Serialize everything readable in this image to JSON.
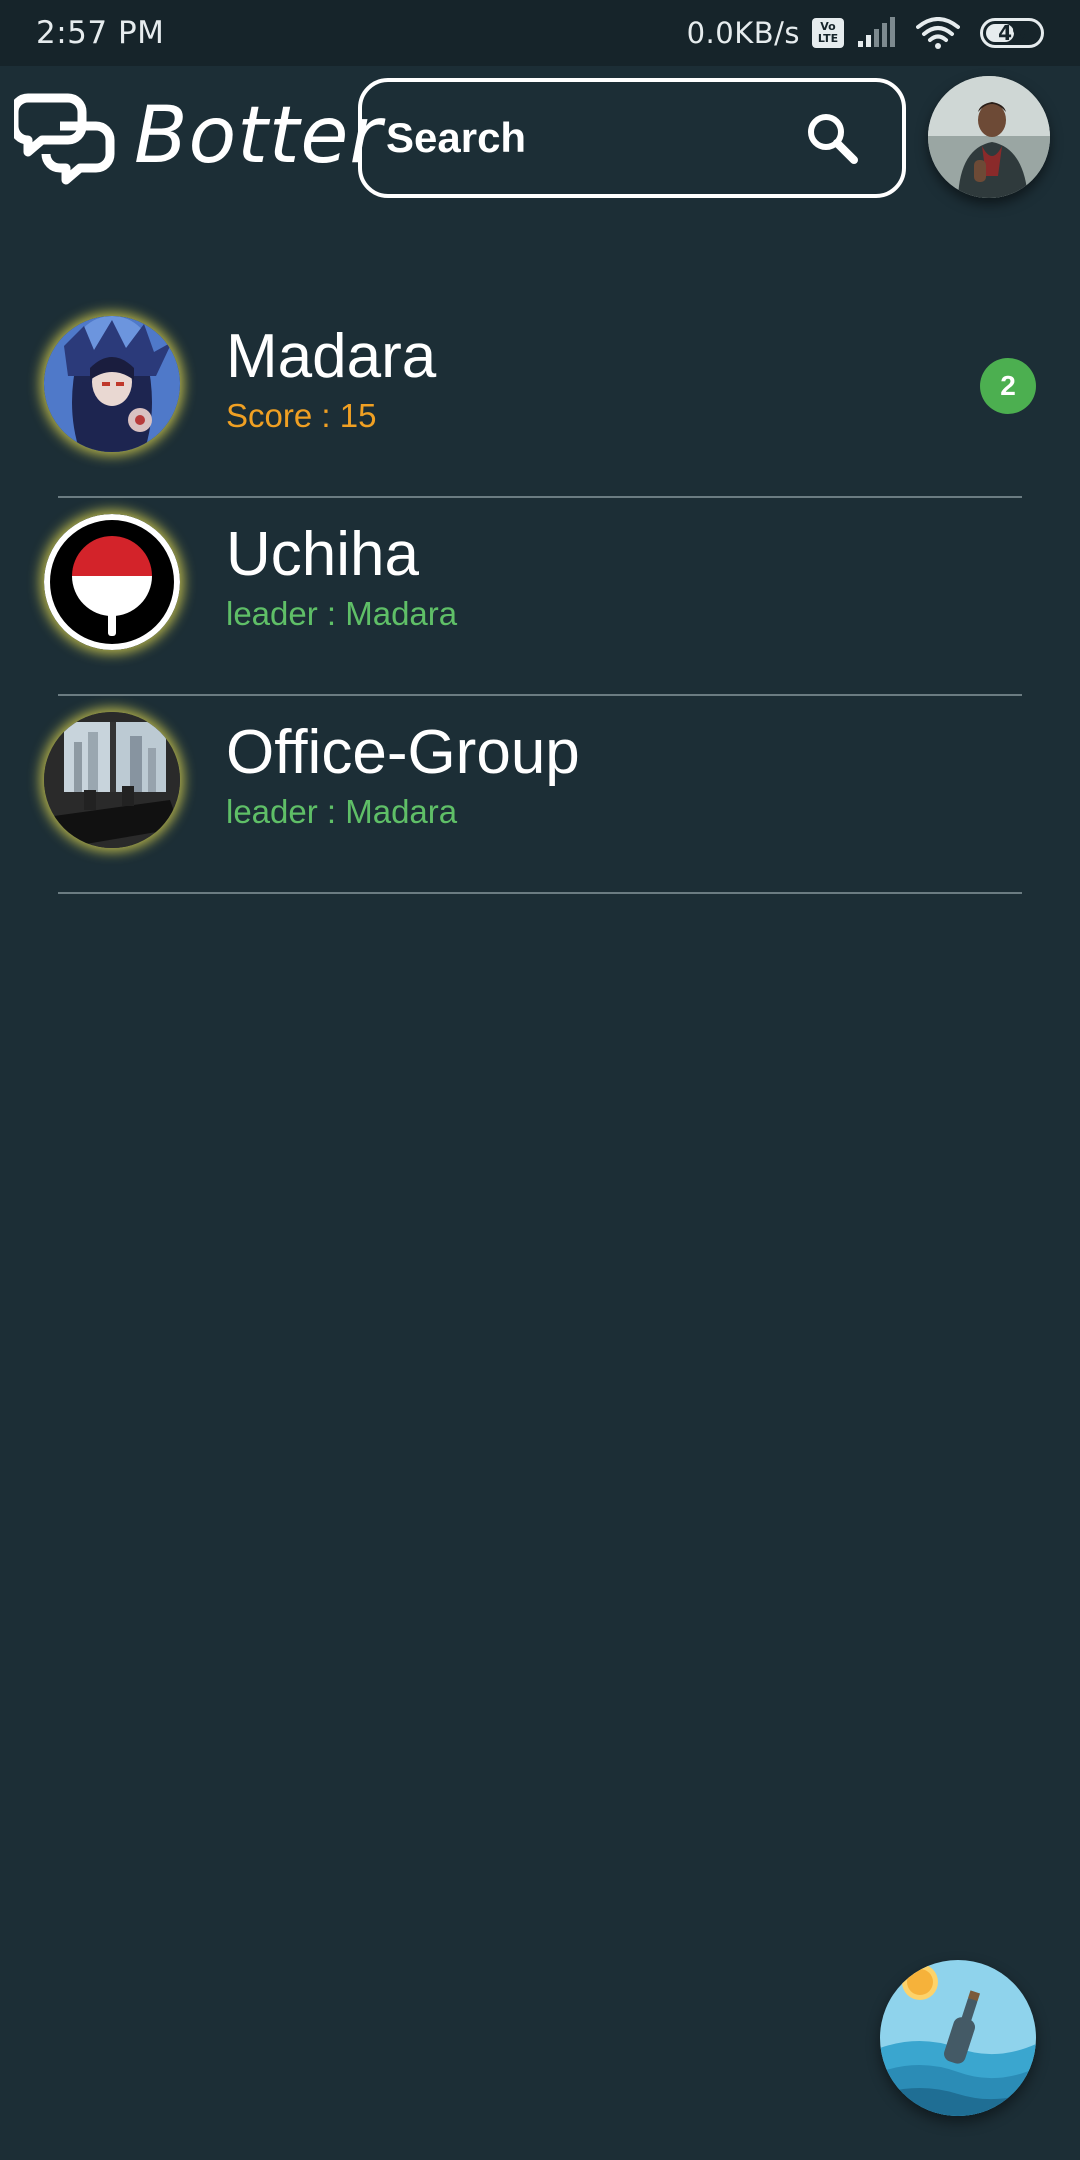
{
  "status_bar": {
    "time": "2:57 PM",
    "net_speed": "0.0KB/s",
    "volte_top": "Vo",
    "volte_bottom": "LTE",
    "battery": "49"
  },
  "header": {
    "app_name": "Botter",
    "search_label": "Search"
  },
  "chats": [
    {
      "name": "Madara",
      "subtitle": "Score : 15",
      "badge": "2"
    },
    {
      "name": "Uchiha",
      "subtitle": "leader : Madara"
    },
    {
      "name": "Office-Group",
      "subtitle": "leader : Madara"
    }
  ],
  "colors": {
    "background": "#1c2e36",
    "status_bar": "#16242a",
    "score": "#f0a023",
    "leader": "#5fbf67",
    "badge": "#4caf50"
  },
  "icons": [
    "logo-icon",
    "search-icon",
    "signal-icon",
    "wifi-icon",
    "battery-icon",
    "message-in-bottle-icon"
  ]
}
